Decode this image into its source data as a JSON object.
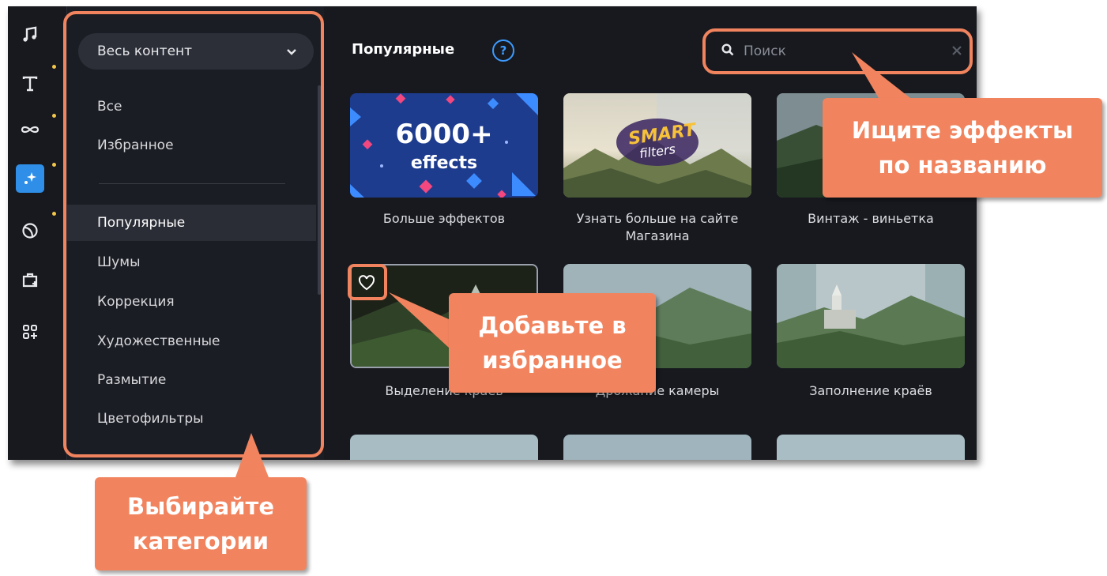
{
  "rail": {
    "icons": [
      "music-icon",
      "text-icon",
      "transitions-icon",
      "filters-icon",
      "stickers-icon",
      "store-icon",
      "more-icon"
    ]
  },
  "sidebar": {
    "dropdown_value": "Весь контент",
    "top_items": [
      "Все",
      "Избранное"
    ],
    "categories": [
      "Популярные",
      "Шумы",
      "Коррекция",
      "Художественные",
      "Размытие",
      "Цветофильтры"
    ],
    "active_category": "Популярные"
  },
  "main": {
    "title": "Популярные",
    "help_symbol": "?",
    "search_placeholder": "Поиск",
    "promo": {
      "effects_count": "6000+",
      "effects_word": "effects",
      "smart_word": "SMART",
      "filters_word": "filters"
    },
    "tiles": [
      {
        "label": "Больше эффектов"
      },
      {
        "label": "Узнать больше на сайте Магазина"
      },
      {
        "label": "Винтаж - виньетка"
      },
      {
        "label": "Выделение краёв"
      },
      {
        "label": "Дрожание камеры"
      },
      {
        "label": "Заполнение краёв"
      }
    ]
  },
  "callouts": {
    "search": "Ищите эффекты по названию",
    "favorite": "Добавьте в избранное",
    "categories": "Выбирайте категории"
  },
  "colors": {
    "accent": "#2f8fe8",
    "callout": "#f1845e",
    "background": "#17191f",
    "sidebar": "#1b1d24"
  }
}
